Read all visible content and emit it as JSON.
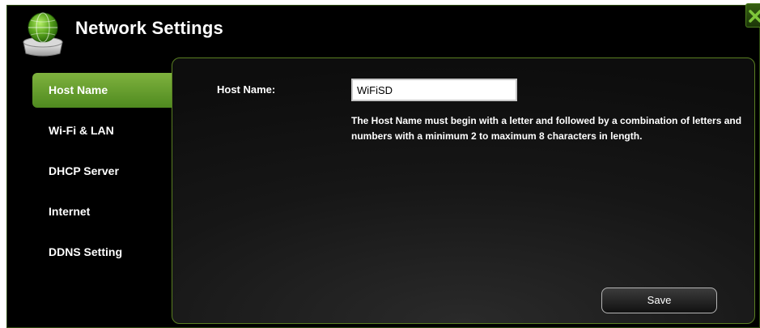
{
  "window": {
    "title": "Network Settings",
    "close_icon": "close-x-icon",
    "app_icon": "network-globe-icon"
  },
  "sidebar": {
    "items": [
      {
        "label": "Host Name",
        "active": true
      },
      {
        "label": "Wi-Fi & LAN",
        "active": false
      },
      {
        "label": "DHCP Server",
        "active": false
      },
      {
        "label": "Internet",
        "active": false
      },
      {
        "label": "DDNS Setting",
        "active": false
      }
    ]
  },
  "form": {
    "host_name_label": "Host Name:",
    "host_name_value": "WiFiSD",
    "help_text": "The Host Name must begin with a letter and followed by a combination of letters and numbers with a minimum 2 to maximum 8 characters in length.",
    "save_label": "Save"
  },
  "colors": {
    "accent_green": "#6aa22f",
    "background": "#000000",
    "text": "#ffffff"
  }
}
